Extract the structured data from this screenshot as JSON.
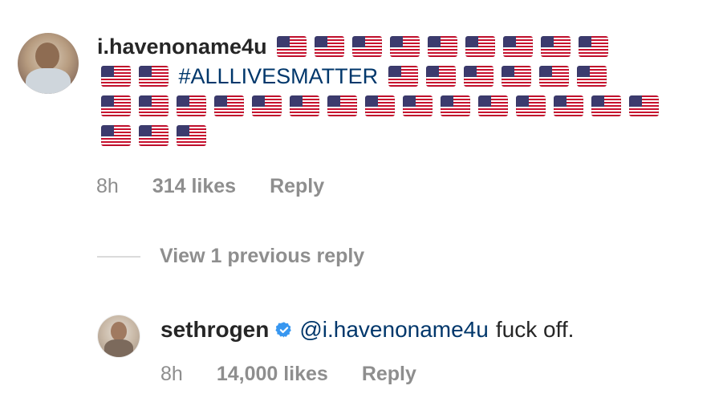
{
  "comment": {
    "username": "i.havenoname4u",
    "hashtag": "#ALLLIVESMATTER",
    "flag_icon": "us-flag-icon",
    "time": "8h",
    "likes": "314 likes",
    "reply_label": "Reply"
  },
  "view_previous": {
    "label": "View 1 previous reply"
  },
  "reply": {
    "username": "sethrogen",
    "verified_icon": "verified-badge-icon",
    "mention": "@i.havenoname4u",
    "text": "fuck off.",
    "time": "8h",
    "likes": "14,000 likes",
    "reply_label": "Reply"
  },
  "colors": {
    "text": "#262626",
    "muted": "#8e8e8e",
    "link": "#00376b",
    "verified": "#3897f0"
  }
}
